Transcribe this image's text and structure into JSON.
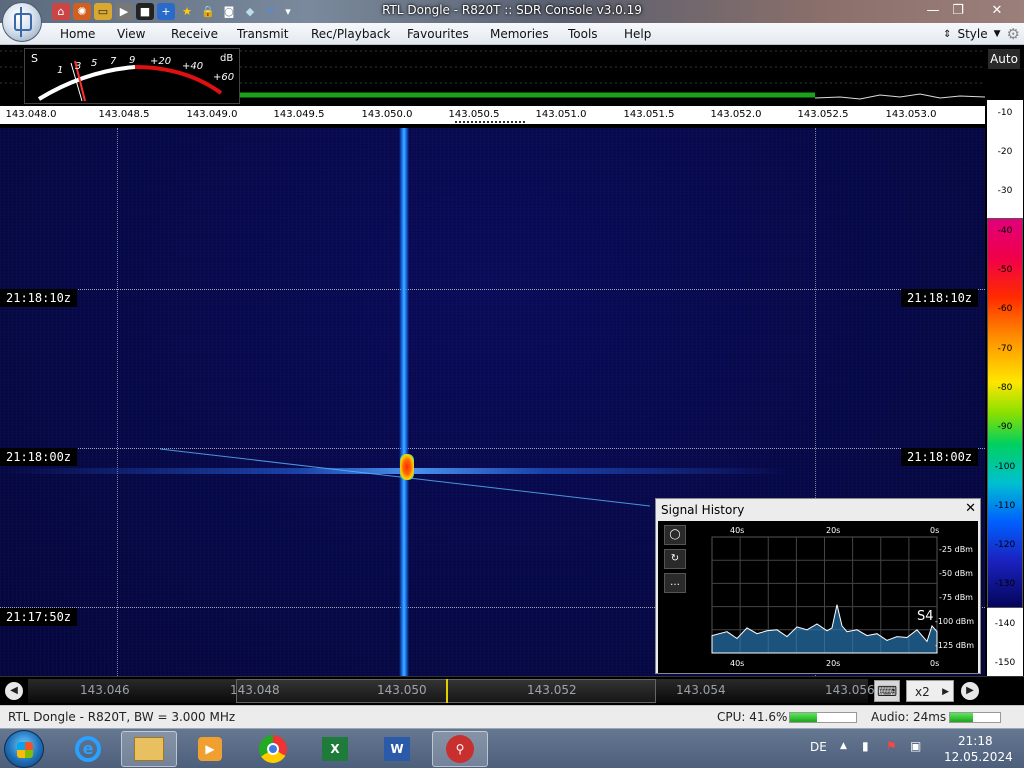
{
  "window": {
    "title": "RTL Dongle - R820T :: SDR Console v3.0.19",
    "controls": [
      "minimize-icon",
      "maximize-icon",
      "close-icon"
    ]
  },
  "quick_access": {
    "icons": [
      "home-icon",
      "settings-gear-icon",
      "folder-icon",
      "play-icon",
      "stop-icon",
      "add-icon",
      "star-icon",
      "lock-icon",
      "camera-icon",
      "drop-icon",
      "undo-icon",
      "dropdown-icon"
    ]
  },
  "menu": {
    "items": [
      {
        "label": "Home"
      },
      {
        "label": "View"
      },
      {
        "label": "Receive"
      },
      {
        "label": "Transmit"
      },
      {
        "label": "Rec/Playback"
      },
      {
        "label": "Favourites"
      },
      {
        "label": "Memories"
      },
      {
        "label": "Tools"
      },
      {
        "label": "Help"
      }
    ],
    "style_label": "Style"
  },
  "smeter": {
    "s_label": "S",
    "db_label": "dB",
    "scale": [
      "1",
      "3",
      "5",
      "7",
      "9",
      "+20",
      "+40",
      "+60"
    ],
    "reading_s": "S4"
  },
  "spectrum": {
    "auto_label": "Auto",
    "freq_labels": [
      "143.048.0",
      "143.048.5",
      "143.049.0",
      "143.049.5",
      "143.050.0",
      "143.050.5",
      "143.051.0",
      "143.051.5",
      "143.052.0",
      "143.052.5",
      "143.053.0"
    ]
  },
  "waterfall": {
    "timestamps": [
      "21:18:10z",
      "21:18:00z",
      "21:17:50z"
    ]
  },
  "legend": {
    "db_labels": [
      "-10",
      "-20",
      "-30",
      "-40",
      "-50",
      "-60",
      "-70",
      "-80",
      "-90",
      "-100",
      "-110",
      "-120",
      "-130",
      "-140",
      "-150"
    ]
  },
  "bottom_scroll": {
    "freq_labels": [
      "143.046",
      "143.048",
      "143.050",
      "143.052",
      "143.054",
      "143.056"
    ],
    "zoom_label": "x2"
  },
  "signal_history": {
    "title": "Signal History",
    "time_labels_top": [
      "40s",
      "20s",
      "0s"
    ],
    "time_labels_bottom": [
      "40s",
      "20s",
      "0s"
    ],
    "db_labels": [
      "-25 dBm",
      "-50 dBm",
      "-75 dBm",
      "-100 dBm",
      "-125 dBm"
    ],
    "s_reading": "S4",
    "chart_data": {
      "type": "area",
      "x": [
        -45,
        -42,
        -40,
        -38,
        -36,
        -34,
        -32,
        -30,
        -28,
        -26,
        -24,
        -22,
        -21,
        -20,
        -19,
        -18,
        -16,
        -14,
        -12,
        -10,
        -8,
        -6,
        -4,
        -2,
        -1,
        0
      ],
      "ylim": [
        -130,
        -10
      ],
      "series": [
        {
          "values": [
            -112,
            -108,
            -115,
            -104,
            -110,
            -107,
            -106,
            -113,
            -103,
            -106,
            -100,
            -107,
            -104,
            -80,
            -102,
            -108,
            -106,
            -112,
            -110,
            -117,
            -113,
            -114,
            -106,
            -118,
            -102,
            -108
          ]
        }
      ]
    }
  },
  "status": {
    "device": "RTL Dongle - R820T, BW = 3.000 MHz",
    "cpu": "CPU: 41.6%",
    "cpu_fraction": 0.416,
    "audio": "Audio: 24ms",
    "audio_fraction": 0.45
  },
  "taskbar": {
    "apps": [
      "internet-explorer-icon",
      "file-explorer-icon",
      "media-player-icon",
      "chrome-icon",
      "excel-icon",
      "word-icon",
      "sdr-console-icon"
    ],
    "language": "DE",
    "time": "21:18",
    "date": "12.05.2024"
  }
}
